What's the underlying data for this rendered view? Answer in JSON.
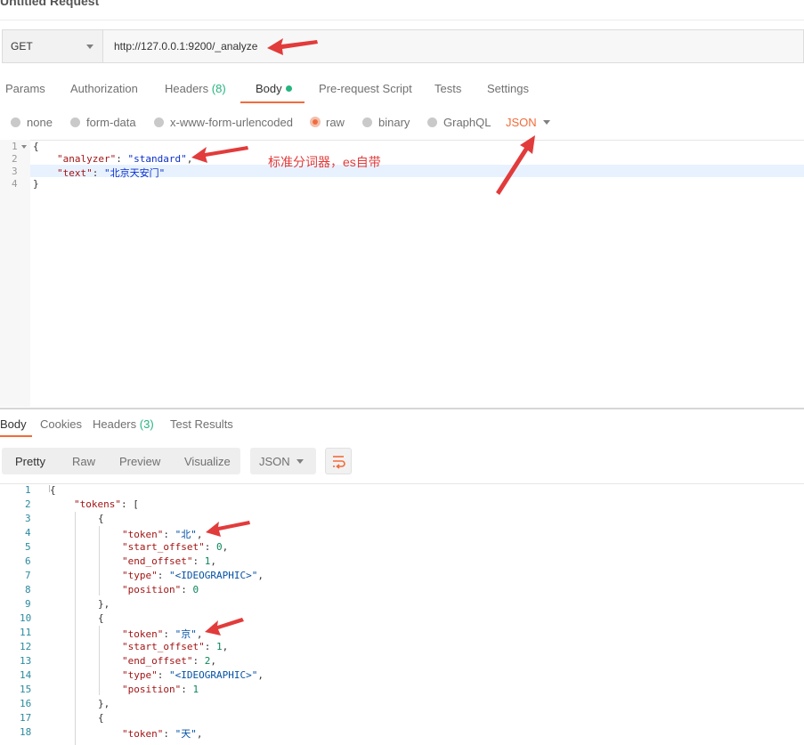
{
  "window": {
    "title": "Untitled Request"
  },
  "request": {
    "method": "GET",
    "url": "http://127.0.0.1:9200/_analyze"
  },
  "request_tabs": [
    {
      "label": "Params"
    },
    {
      "label": "Authorization"
    },
    {
      "label": "Headers",
      "count": "(8)"
    },
    {
      "label": "Body",
      "active": true
    },
    {
      "label": "Pre-request Script"
    },
    {
      "label": "Tests"
    },
    {
      "label": "Settings"
    }
  ],
  "body_types": [
    {
      "label": "none"
    },
    {
      "label": "form-data"
    },
    {
      "label": "x-www-form-urlencoded"
    },
    {
      "label": "raw",
      "selected": true
    },
    {
      "label": "binary"
    },
    {
      "label": "GraphQL"
    }
  ],
  "raw_format": "JSON",
  "request_body": {
    "line_numbers": [
      "1",
      "2",
      "3",
      "4"
    ],
    "lines": [
      {
        "text": "{"
      },
      {
        "key": "\"analyzer\"",
        "colon": ": ",
        "value": "\"standard\"",
        "end": ","
      },
      {
        "key": "\"text\"",
        "colon": ": ",
        "value": "\"北京天安门\"",
        "end": ""
      },
      {
        "text": "}"
      }
    ]
  },
  "annotation": {
    "text": "标准分词器，es自带"
  },
  "response_tabs": [
    {
      "label": "Body",
      "active": true
    },
    {
      "label": "Cookies"
    },
    {
      "label": "Headers",
      "count": "(3)"
    },
    {
      "label": "Test Results"
    }
  ],
  "view_modes": [
    {
      "label": "Pretty",
      "active": true
    },
    {
      "label": "Raw"
    },
    {
      "label": "Preview"
    },
    {
      "label": "Visualize"
    }
  ],
  "response_format": "JSON",
  "response_body": {
    "line_numbers": [
      "1",
      "2",
      "3",
      "4",
      "5",
      "6",
      "7",
      "8",
      "9",
      "10",
      "11",
      "12",
      "13",
      "14",
      "15",
      "16",
      "17",
      "18"
    ],
    "lines": [
      "{",
      "\"tokens\": [",
      "{",
      "\"token\": \"北\",",
      "\"start_offset\": 0,",
      "\"end_offset\": 1,",
      "\"type\": \"<IDEOGRAPHIC>\",",
      "\"position\": 0",
      "},",
      "{",
      "\"token\": \"京\",",
      "\"start_offset\": 1,",
      "\"end_offset\": 2,",
      "\"type\": \"<IDEOGRAPHIC>\",",
      "\"position\": 1",
      "},",
      "{",
      "\"token\": \"天\","
    ]
  },
  "colors": {
    "accent": "#f26b3a",
    "green": "#26b47f",
    "arrow": "#e23b3b"
  }
}
